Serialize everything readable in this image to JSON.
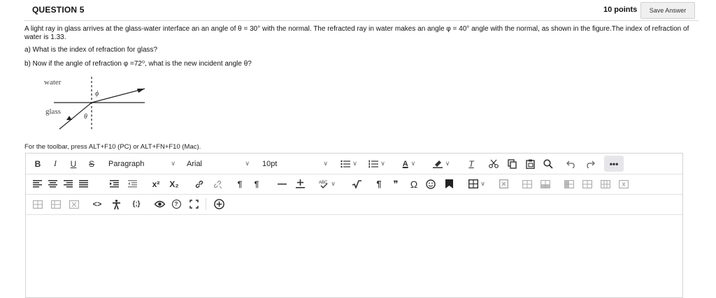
{
  "question": {
    "title": "QUESTION 5",
    "points": "10 points",
    "save_label": "Save Answer",
    "text": "A light ray in glass arrives at the glass-water interface an an angle of  θ = 30° with the normal. The refracted ray in water makes an angle  φ = 40° angle with the normal, as shown in the figure.The index of refraction of water is 1.33.",
    "part_a": "a) What is the index of refraction for glass?",
    "part_b": "b) Now if the angle of refraction  φ =72⁰,  what is the new incident angle θ?"
  },
  "figure": {
    "label_water": "water",
    "label_glass": "glass",
    "symbol_phi": "ϕ",
    "symbol_theta": "θ"
  },
  "editor": {
    "toolbar_hint": "For the toolbar, press ALT+F10 (PC) or ALT+FN+F10 (Mac).",
    "bold": "B",
    "italic": "I",
    "underline": "U",
    "strike": "S",
    "paragraph": "Paragraph",
    "font": "Arial",
    "size": "10pt",
    "superscript": "x²",
    "subscript": "X₂",
    "more": "•••",
    "chevron": "∨",
    "text_color_letter": "A",
    "clear_format_letter": "T",
    "pilcrow": "¶",
    "quote": "❞",
    "omega": "Ω",
    "code": "<>",
    "braces": "{;}",
    "help": "?"
  },
  "colors": {
    "accent_bar": "#e2001a",
    "border": "#d4d4d4",
    "button_bg": "#f0f0f0"
  }
}
